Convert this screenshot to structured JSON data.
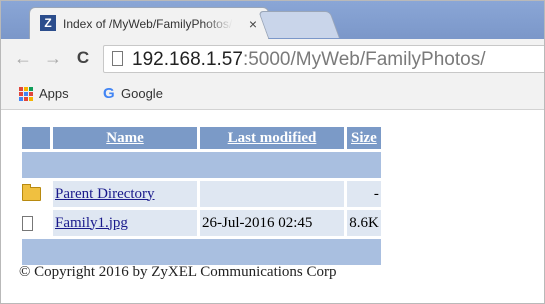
{
  "browser": {
    "tab_title": "Index of /MyWeb/FamilyPhotos/",
    "tab_favicon_letter": "Z",
    "tab_close": "×",
    "nav": {
      "back": "←",
      "forward": "→",
      "reload": "C"
    },
    "url_host": "192.168.1.57",
    "url_rest": ":5000/MyWeb/FamilyPhotos/",
    "bookmarks": [
      {
        "label": "Apps",
        "icon": "apps-grid-icon"
      },
      {
        "label": "Google",
        "icon": "google-g-icon"
      }
    ],
    "google_letter": "G"
  },
  "listing": {
    "headers": {
      "name": "Name",
      "last_modified": "Last modified",
      "size": "Size"
    },
    "rows": [
      {
        "icon": "folder-icon",
        "name": "Parent Directory",
        "last_modified": "",
        "size": "-"
      },
      {
        "icon": "file-icon",
        "name": "Family1.jpg",
        "last_modified": "26-Jul-2016 02:45",
        "size": "8.6K"
      }
    ]
  },
  "footer": {
    "copyright": "© Copyright 2016 by ZyXEL Communications Corp"
  },
  "colors": {
    "header_bg": "#7b9ac7",
    "separator_bg": "#a9bfe0",
    "row_bg": "#dfe7f2",
    "link": "#1a1a8c"
  }
}
